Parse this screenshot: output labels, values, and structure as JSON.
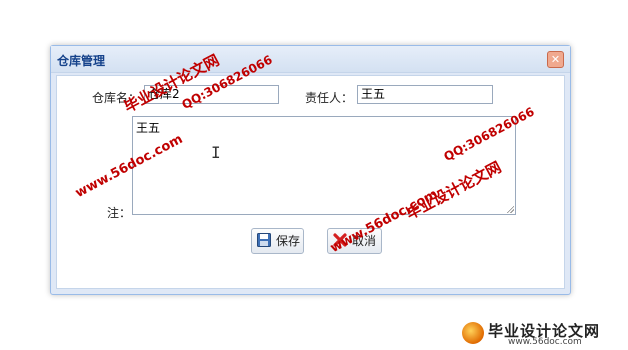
{
  "dialog": {
    "title": "仓库管理",
    "close_icon": "close-icon"
  },
  "form": {
    "warehouse_label": "仓库名：",
    "warehouse_value": "仓库2",
    "manager_label": "责任人：",
    "manager_value": "王五",
    "remark_label": "备注：",
    "remark_label_visible": "注：",
    "remark_value": "王五"
  },
  "buttons": {
    "save_label": "保存",
    "save_icon": "floppy-disk-icon",
    "cancel_label": "取消",
    "cancel_icon": "cancel-x-icon"
  },
  "watermarks": {
    "site_name": "毕业设计论文网",
    "qq": "QQ:306826066",
    "url": "www.56doc.com"
  },
  "footer": {
    "logo_name": "毕业设计论文网",
    "logo_url": "www.56doc.com"
  },
  "colors": {
    "title_text": "#15428b",
    "watermark": "#c00000",
    "border": "#99bbe8"
  }
}
